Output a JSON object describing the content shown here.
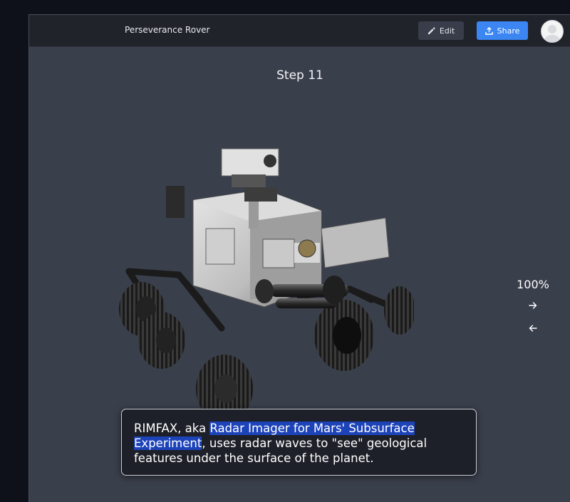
{
  "header": {
    "title": "Perseverance Rover",
    "edit_label": "Edit",
    "share_label": "Share",
    "avatar_icon": "user-avatar-icon"
  },
  "step": {
    "label": "Step 11"
  },
  "zoom": {
    "level": "100%",
    "next_icon": "arrow-right-icon",
    "prev_icon": "arrow-left-icon"
  },
  "caption": {
    "before": "RIMFAX, aka ",
    "highlight": "Radar Imager for Mars' Subsurface Experiment",
    "after": ", uses radar waves to \"see\" geological features under the surface of the planet."
  },
  "colors": {
    "background": "#3a3f4c",
    "header": "#20232a",
    "share_button": "#3b86f2",
    "highlight": "#1d43b9",
    "caption_bg": "#1d2028"
  }
}
